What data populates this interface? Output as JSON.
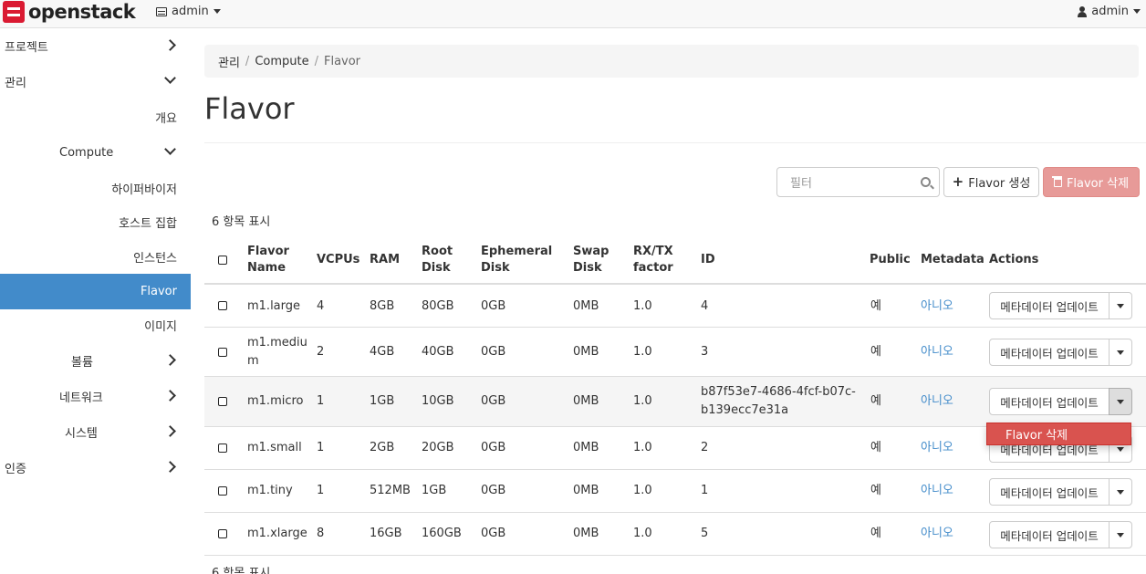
{
  "navbar": {
    "logo_text": "openstack",
    "project": "admin",
    "user": "admin"
  },
  "sidebar": {
    "items": [
      {
        "label": "프로젝트"
      },
      {
        "label": "관리"
      },
      {
        "label": "개요"
      },
      {
        "label": "Compute"
      },
      {
        "label": "하이퍼바이저"
      },
      {
        "label": "호스트 집합"
      },
      {
        "label": "인스턴스"
      },
      {
        "label": "Flavor"
      },
      {
        "label": "이미지"
      },
      {
        "label": "볼륨"
      },
      {
        "label": "네트워크"
      },
      {
        "label": "시스템"
      },
      {
        "label": "인증"
      }
    ]
  },
  "breadcrumb": {
    "items": [
      "관리",
      "Compute",
      "Flavor"
    ],
    "separator": "/"
  },
  "page_title": "Flavor",
  "toolbar": {
    "filter_placeholder": "필터",
    "create_label": "Flavor 생성",
    "delete_label": "Flavor 삭제"
  },
  "table": {
    "count_top": "6 항목 표시",
    "count_bottom": "6 항목 표시",
    "headers": {
      "name_line1": "Flavor",
      "name_line2": "Name",
      "vcpus": "VCPUs",
      "ram": "RAM",
      "root_line1": "Root",
      "root_line2": "Disk",
      "eph_line1": "Ephemeral",
      "eph_line2": "Disk",
      "swap_line1": "Swap",
      "swap_line2": "Disk",
      "rxtx_line1": "RX/TX",
      "rxtx_line2": "factor",
      "id": "ID",
      "public": "Public",
      "metadata": "Metadata",
      "actions": "Actions"
    },
    "rows": [
      {
        "name": "m1.large",
        "vcpus": "4",
        "ram": "8GB",
        "root": "80GB",
        "eph": "0GB",
        "swap": "0MB",
        "rxtx": "1.0",
        "id": "4",
        "public": "예",
        "metadata": "아니오",
        "action": "메타데이터 업데이트"
      },
      {
        "name": "m1.mediu",
        "name2": "m",
        "vcpus": "2",
        "ram": "4GB",
        "root": "40GB",
        "eph": "0GB",
        "swap": "0MB",
        "rxtx": "1.0",
        "id": "3",
        "public": "예",
        "metadata": "아니오",
        "action": "메타데이터 업데이트"
      },
      {
        "name": "m1.micro",
        "vcpus": "1",
        "ram": "1GB",
        "root": "10GB",
        "eph": "0GB",
        "swap": "0MB",
        "rxtx": "1.0",
        "id": "b87f53e7-4686-4fcf-b07c-",
        "id2": "b139ecc7e31a",
        "public": "예",
        "metadata": "아니오",
        "action": "메타데이터 업데이트"
      },
      {
        "name": "m1.small",
        "vcpus": "1",
        "ram": "2GB",
        "root": "20GB",
        "eph": "0GB",
        "swap": "0MB",
        "rxtx": "1.0",
        "id": "2",
        "public": "예",
        "metadata": "아니오",
        "action": "메타데이터 업데이트"
      },
      {
        "name": "m1.tiny",
        "vcpus": "1",
        "ram": "512MB",
        "root": "1GB",
        "eph": "0GB",
        "swap": "0MB",
        "rxtx": "1.0",
        "id": "1",
        "public": "예",
        "metadata": "아니오",
        "action": "메타데이터 업데이트"
      },
      {
        "name": "m1.xlarge",
        "vcpus": "8",
        "ram": "16GB",
        "root": "160GB",
        "eph": "0GB",
        "swap": "0MB",
        "rxtx": "1.0",
        "id": "5",
        "public": "예",
        "metadata": "아니오",
        "action": "메타데이터 업데이트"
      }
    ]
  },
  "dropdown": {
    "item": "Flavor 삭제"
  },
  "colors": {
    "accent": "#428bca",
    "danger": "#d9534f",
    "danger_disabled": "#e79a98"
  }
}
